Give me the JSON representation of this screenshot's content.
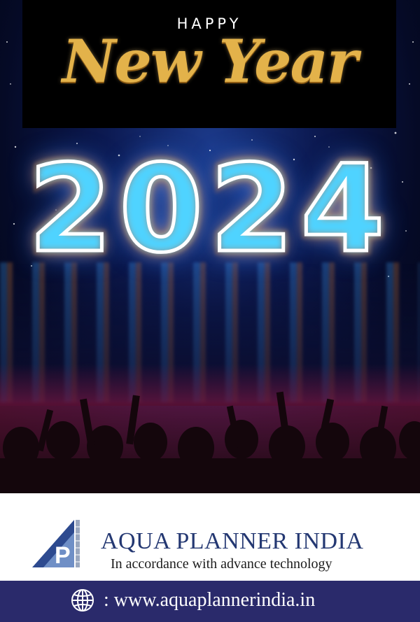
{
  "greeting": {
    "happy": "HAPPY",
    "new_year": "New Year",
    "year": "2024"
  },
  "brand": {
    "name": "AQUA PLANNER INDIA",
    "tagline": "In accordance with advance technology",
    "logo_letter": "P"
  },
  "footer": {
    "url": ": www.aquaplannerindia.in",
    "icon": "globe-icon"
  },
  "colors": {
    "gold": "#e3b24a",
    "brand_blue": "#243872",
    "footer_bg": "#2a2a6b",
    "neon_blue": "#4fd3ff",
    "neon_orange": "#ff8a2a"
  }
}
